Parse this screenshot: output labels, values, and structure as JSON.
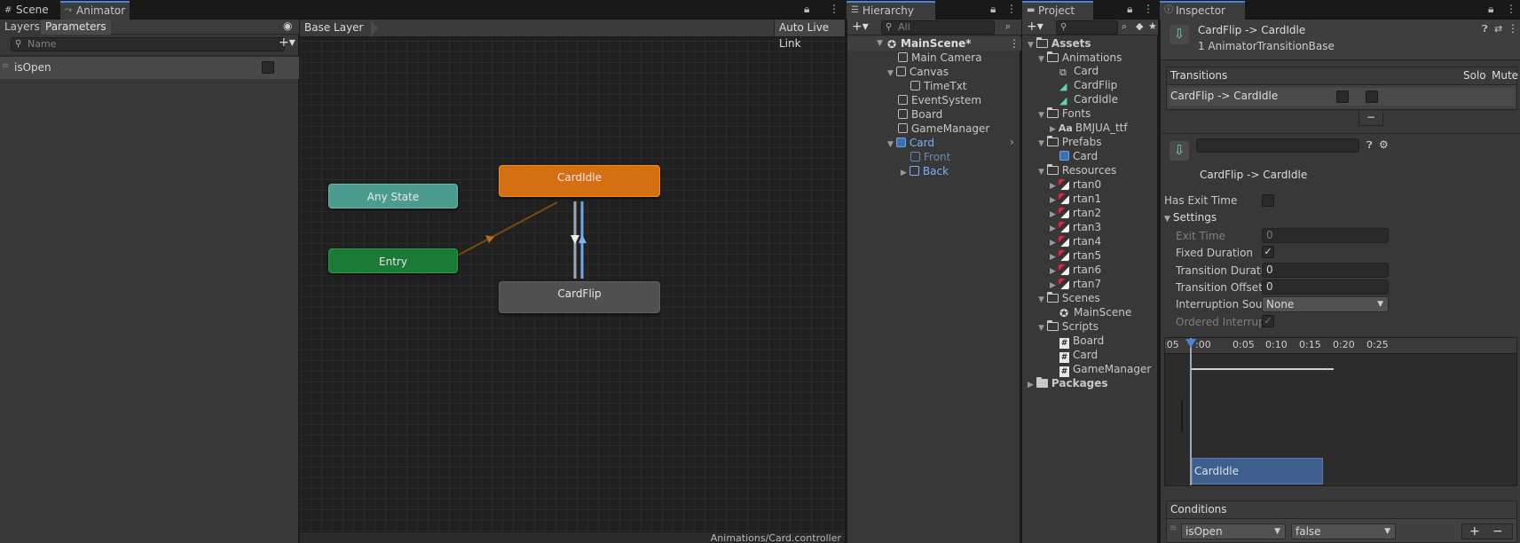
{
  "colors": {
    "accent": "#4c84d6",
    "any_state": "#4b9b8f",
    "entry": "#1b7a35",
    "default_state": "#d46f12",
    "state": "#505050",
    "transition_selected": "#8ab8ee",
    "selection_text": "#7ab1f5"
  },
  "scene_tab": {
    "label": "Scene",
    "icon": "grid-icon"
  },
  "animator": {
    "tab_label": "Animator",
    "layers_tab": "Layers",
    "parameters_tab": "Parameters",
    "search_placeholder": "Name",
    "parameter_name": "isOpen",
    "breadcrumb": "Base Layer",
    "auto_live_link": "Auto Live Link",
    "footer_path": "Animations/Card.controller",
    "nodes": {
      "any_state": "Any State",
      "entry": "Entry",
      "card_idle": "CardIdle",
      "card_flip": "CardFlip"
    }
  },
  "hierarchy": {
    "tab_label": "Hierarchy",
    "search_placeholder": "All",
    "scene": "MainScene*",
    "items": [
      {
        "label": "Main Camera"
      },
      {
        "label": "Canvas"
      },
      {
        "label": "TimeTxt"
      },
      {
        "label": "EventSystem"
      },
      {
        "label": "Board"
      },
      {
        "label": "GameManager"
      },
      {
        "label": "Card"
      },
      {
        "label": "Front"
      },
      {
        "label": "Back"
      }
    ]
  },
  "project": {
    "tab_label": "Project",
    "assets": "Assets",
    "animations": "Animations",
    "anim_items": [
      "Card",
      "CardFlip",
      "CardIdle"
    ],
    "fonts": "Fonts",
    "font_icon": "Aa",
    "font_item": "BMJUA_ttf",
    "prefabs": "Prefabs",
    "prefab_item": "Card",
    "resources": "Resources",
    "resource_items": [
      "rtan0",
      "rtan1",
      "rtan2",
      "rtan3",
      "rtan4",
      "rtan5",
      "rtan6",
      "rtan7"
    ],
    "scenes": "Scenes",
    "scene_item": "MainScene",
    "scripts": "Scripts",
    "script_items": [
      "Board",
      "Card",
      "GameManager"
    ],
    "packages": "Packages"
  },
  "inspector": {
    "tab_label": "Inspector",
    "title": "CardFlip -> CardIdle",
    "subtitle": "1 AnimatorTransitionBase",
    "transitions_header": "Transitions",
    "solo": "Solo",
    "mute": "Mute",
    "transition_item": "CardFlip -> CardIdle",
    "minus": "−",
    "name_field": "",
    "transition_label": "CardFlip -> CardIdle",
    "has_exit_time": "Has Exit Time",
    "settings": "Settings",
    "exit_time": "Exit Time",
    "exit_time_value": "0",
    "fixed_duration": "Fixed Duration",
    "transition_duration": "Transition Duration",
    "transition_duration_value": "0",
    "transition_offset": "Transition Offset",
    "transition_offset_value": "0",
    "interruption_source": "Interruption Source",
    "interruption_value": "None",
    "ordered_interruption": "Ordered Interruption",
    "timeline_ticks": [
      ":05",
      ":00",
      "0:05",
      "0:10",
      "0:15",
      "0:20",
      "0:25"
    ],
    "timeline_clip": "CardIdle",
    "conditions": "Conditions",
    "condition_param": "isOpen",
    "condition_value": "false",
    "plus": "+",
    "minus2": "−"
  }
}
